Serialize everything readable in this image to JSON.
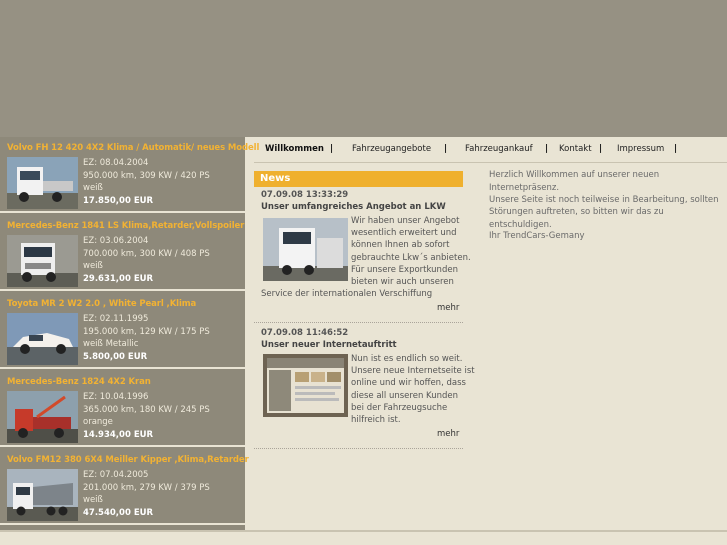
{
  "nav": {
    "items": [
      "Willkommen",
      "Fahrzeugangebote",
      "Fahrzeugankauf",
      "Kontakt",
      "Impressum"
    ],
    "separator": "|"
  },
  "vehicles": [
    {
      "title": "Volvo FH 12 420 4X2 Klima / Automatik/ neues Modell",
      "ez": "EZ: 08.04.2004",
      "specs": "950.000 km, 309 KW / 420 PS",
      "color": "weiß",
      "price": "17.850,00 EUR"
    },
    {
      "title": "Mercedes-Benz 1841 LS Klima,Retarder,Vollspoiler",
      "ez": "EZ: 03.06.2004",
      "specs": "700.000 km, 300 KW / 408 PS",
      "color": "weiß",
      "price": "29.631,00 EUR"
    },
    {
      "title": "Toyota MR 2 W2 2.0 , White Pearl ,Klima",
      "ez": "EZ: 02.11.1995",
      "specs": "195.000 km, 129 KW / 175 PS",
      "color": "weiß Metallic",
      "price": "5.800,00 EUR"
    },
    {
      "title": "Mercedes-Benz 1824 4X2 Kran",
      "ez": "EZ: 10.04.1996",
      "specs": "365.000 km, 180 KW / 245 PS",
      "color": "orange",
      "price": "14.934,00 EUR"
    },
    {
      "title": "Volvo FM12 380 6X4 Meiller Kipper ,Klima,Retarder",
      "ez": "EZ: 07.04.2005",
      "specs": "201.000 km, 279 KW / 379 PS",
      "color": "weiß",
      "price": "47.540,00 EUR"
    }
  ],
  "news": {
    "heading": "News",
    "more_label": "mehr",
    "items": [
      {
        "date": "07.09.08 13:33:29",
        "title": "Unser umfangreiches Angebot an LKW",
        "lines": [
          "Wir haben unser Angebot",
          "wesentlich erweitert und",
          "können Ihnen ab sofort",
          "gebrauchte Lkw´s anbieten.",
          "Für unsere Exportkunden",
          "bieten wir auch unseren"
        ],
        "last_line": "Service der internationalen Verschiffung"
      },
      {
        "date": "07.09.08 11:46:52",
        "title": "Unser neuer Internetauftritt",
        "lines": [
          "Nun ist es endlich so weit.",
          "Unsere neue Internetseite ist",
          "online und wir hoffen, dass",
          "diese all unseren Kunden",
          "bei der Fahrzeugsuche",
          "hilfreich ist."
        ]
      }
    ]
  },
  "welcome": {
    "line1": "Herzlich Willkommen auf unserer neuen Internetpräsenz.",
    "line2": "Unsere Seite ist noch teilweise in Bearbeitung, sollten",
    "line3": "Störungen auftreten, so bitten wir das zu entschuldigen.",
    "line4": "Ihr TrendCars-Gemany"
  },
  "colors": {
    "accent": "#efb02e",
    "sidebar": "#8e897a",
    "background": "#e9e4d4",
    "header": "#969183"
  }
}
